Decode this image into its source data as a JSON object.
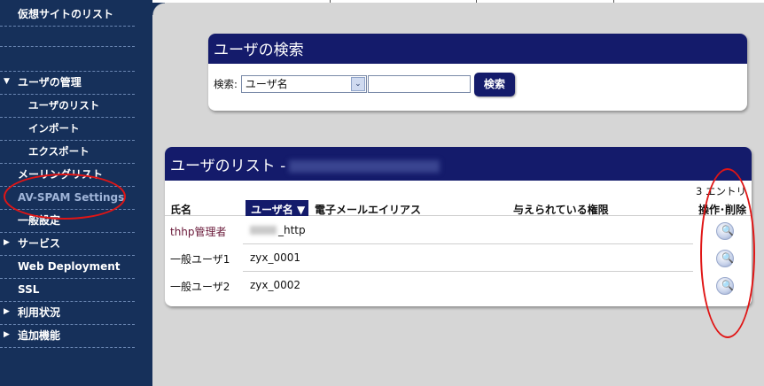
{
  "sidebar": {
    "items": [
      {
        "label": "仮想サイトのリスト"
      },
      {
        "label": "ユーザの管理",
        "arrow": "▼"
      },
      {
        "label": "ユーザのリスト"
      },
      {
        "label": "インポート"
      },
      {
        "label": "エクスポート"
      },
      {
        "label": "メーリングリスト"
      },
      {
        "label": "AV-SPAM Settings"
      },
      {
        "label": "一般設定"
      },
      {
        "label": "サービス",
        "arrow": "▶"
      },
      {
        "label": "Web Deployment"
      },
      {
        "label": "SSL"
      },
      {
        "label": "利用状況",
        "arrow": "▶"
      },
      {
        "label": "追加機能",
        "arrow": "▶"
      }
    ]
  },
  "search": {
    "title": "ユーザの検索",
    "label": "検索:",
    "select_value": "ユーザ名",
    "dropdown_glyph": "⌄",
    "input_value": "",
    "button_label": "検索"
  },
  "user_list": {
    "title": "ユーザのリスト -",
    "entry_count": "3 エントリ",
    "columns": {
      "name": "氏名",
      "username": "ユーザ名 ▼",
      "email_alias": "電子メールエイリアス",
      "permissions": "与えられている権限",
      "actions": "操作･削除"
    },
    "rows": [
      {
        "name": "thhp管理者",
        "username": "_http"
      },
      {
        "name": "一般ユーザ1",
        "username": "zyx_0001"
      },
      {
        "name": "一般ユーザ2",
        "username": "zyx_0002"
      }
    ],
    "zoom_glyph": "🔍"
  },
  "colors": {
    "sidebar_bg": "#16305a",
    "header_bg": "#141b6b",
    "annotation": "#e01515"
  }
}
